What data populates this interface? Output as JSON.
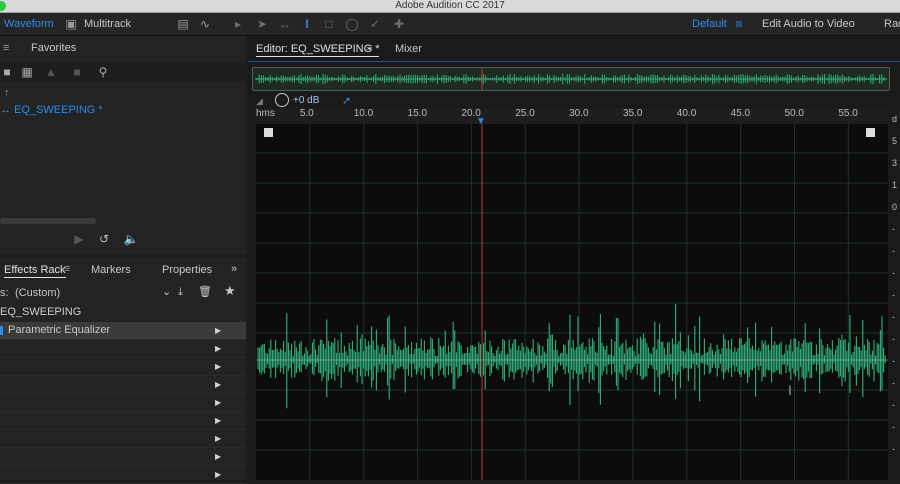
{
  "app": {
    "title": "Adobe Audition CC 2017"
  },
  "toolbar": {
    "waveform_label": "Waveform",
    "multitrack_label": "Multitrack",
    "workspace_default": "Default",
    "workspace_edit_video": "Edit Audio to Video",
    "workspace_radio": "Rad"
  },
  "files_panel": {
    "tab_favorites": "Favorites",
    "file_name": "EQ_SWEEPING *"
  },
  "effects_panel": {
    "tabs": [
      "Effects Rack",
      "Markers",
      "Properties"
    ],
    "preset_prefix": "s:",
    "preset_value": "(Custom)",
    "clip_name": "EQ_SWEEPING",
    "slots": [
      "Parametric Equalizer",
      "",
      "",
      "",
      "",
      "",
      "",
      "",
      "",
      ""
    ]
  },
  "editor": {
    "tab_label": "Editor: EQ_SWEEPING *",
    "mixer_label": "Mixer",
    "volume_label": "+0 dB",
    "ruler_unit": "hms",
    "ruler_ticks": [
      "5.0",
      "10.0",
      "15.0",
      "20.0",
      "25.0",
      "30.0",
      "35.0",
      "40.0",
      "45.0",
      "50.0",
      "55.0"
    ],
    "playhead_seconds": 21.0,
    "right_axis_labels": [
      "d",
      "5",
      "3",
      "1",
      "0",
      "-",
      "-",
      "-",
      "-",
      "-",
      "-",
      "-",
      "-",
      "-",
      "-",
      "-"
    ]
  },
  "colors": {
    "waveform": "#2fb37c",
    "playhead": "#c0392b",
    "accent": "#2d8ceb"
  },
  "icons": [
    "menu-icon",
    "waveform-icon",
    "multitrack-icon",
    "move-tool-icon",
    "razor-tool-icon",
    "time-selection-icon",
    "marquee-icon",
    "lasso-icon",
    "brush-icon",
    "spot-healing-icon",
    "search-icon",
    "play-icon",
    "loop-icon",
    "volume-icon",
    "download-icon",
    "trash-icon",
    "star-icon",
    "chevron-down-icon",
    "dial-icon",
    "pin-icon"
  ]
}
